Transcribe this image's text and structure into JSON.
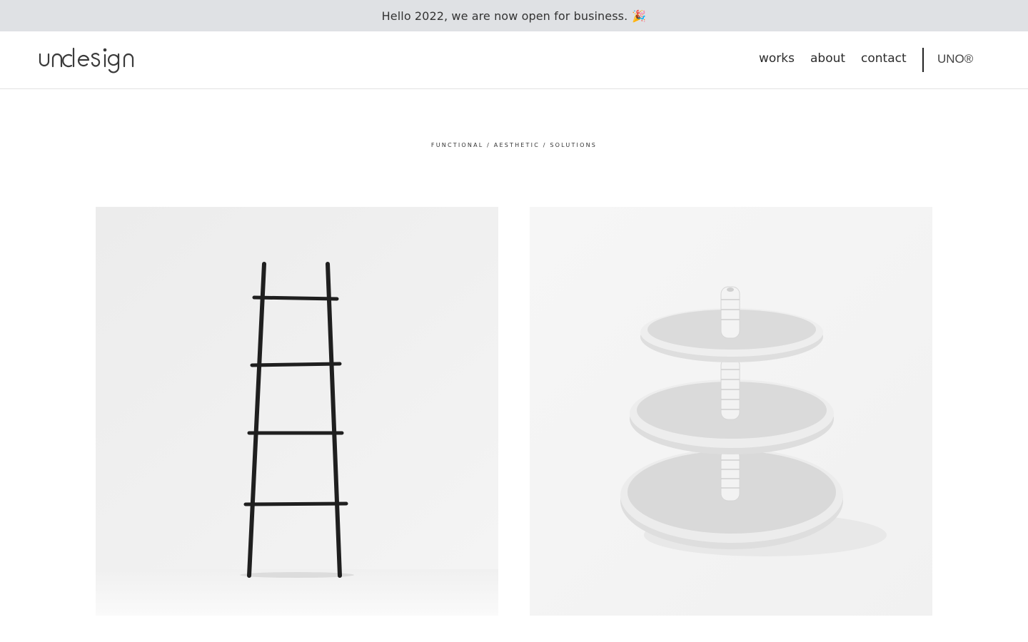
{
  "announcement": {
    "text": "Hello 2022, we are now open for business.",
    "emoji": "🎉"
  },
  "header": {
    "logo_text": "undesign",
    "nav": {
      "works": "works",
      "about": "about",
      "contact": "contact",
      "uno": "UNO®"
    }
  },
  "hero": {
    "tagline": "FUNCTIONAL / AESTHETIC / SOLUTIONS"
  },
  "gallery": {
    "items": [
      {
        "subject": "black ladder",
        "icon": "ladder-image"
      },
      {
        "subject": "three-tier white cake stand",
        "icon": "cake-stand-image"
      }
    ]
  },
  "colors": {
    "announcement_bg": "#dfe1e4",
    "text": "#2b2b2b",
    "divider": "#e2e2e2"
  }
}
